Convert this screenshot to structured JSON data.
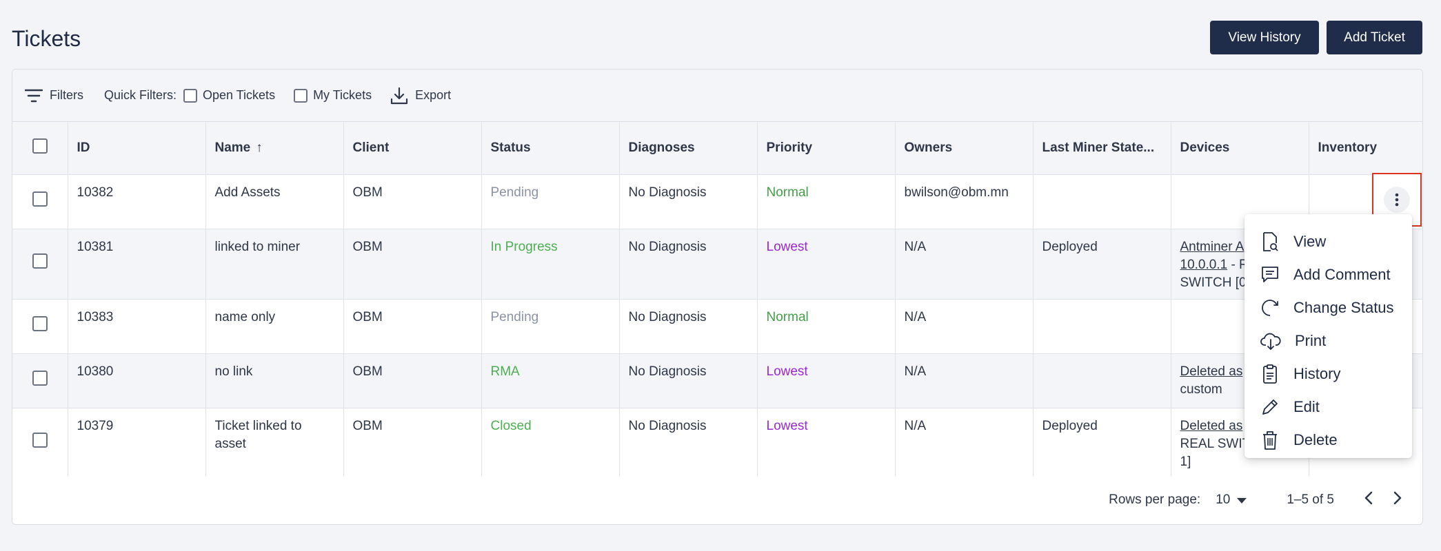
{
  "header": {
    "title": "Tickets",
    "view_history_label": "View History",
    "add_ticket_label": "Add Ticket"
  },
  "toolbar": {
    "filters_label": "Filters",
    "quick_filters_label": "Quick Filters:",
    "open_tickets_label": "Open Tickets",
    "my_tickets_label": "My Tickets",
    "export_label": "Export"
  },
  "table": {
    "columns": [
      "ID",
      "Name",
      "Client",
      "Status",
      "Diagnoses",
      "Priority",
      "Owners",
      "Last Miner State...",
      "Devices",
      "Inventory"
    ],
    "rows": [
      {
        "id": "10382",
        "name": "Add Assets",
        "client": "OBM",
        "status": "Pending",
        "diagnoses": "No Diagnosis",
        "priority": "Normal",
        "owners": "bwilson@obm.mn",
        "last_state": "",
        "devices_link": "",
        "devices_text": ""
      },
      {
        "id": "10381",
        "name": "linked to miner",
        "client": "OBM",
        "status": "In Progress",
        "diagnoses": "No Diagnosis",
        "priority": "Lowest",
        "owners": "N/A",
        "last_state": "Deployed",
        "devices_link": "Antminer A",
        "devices_link2": "10.0.0.1",
        "devices_text": " - R",
        "devices_text2": "SWITCH [0"
      },
      {
        "id": "10383",
        "name": "name only",
        "client": "OBM",
        "status": "Pending",
        "diagnoses": "No Diagnosis",
        "priority": "Normal",
        "owners": "N/A",
        "last_state": "",
        "devices_link": "",
        "devices_text": ""
      },
      {
        "id": "10380",
        "name": "no link",
        "client": "OBM",
        "status": "RMA",
        "diagnoses": "No Diagnosis",
        "priority": "Lowest",
        "owners": "N/A",
        "last_state": "",
        "devices_link": "Deleted as",
        "devices_text": "custom"
      },
      {
        "id": "10379",
        "name": "Ticket linked to asset",
        "client": "OBM",
        "status": "Closed",
        "diagnoses": "No Diagnosis",
        "priority": "Lowest",
        "owners": "N/A",
        "last_state": "Deployed",
        "devices_link": "Deleted as",
        "devices_text": "REAL SWIT",
        "devices_text2": "1]"
      }
    ]
  },
  "footer": {
    "rows_per_page_label": "Rows per page:",
    "rows_per_page_value": "10",
    "range_label": "1–5 of 5"
  },
  "menu": {
    "items": [
      "View",
      "Add Comment",
      "Change Status",
      "Print",
      "History",
      "Edit",
      "Delete"
    ]
  },
  "colors": {
    "primary_dark": "#1f2d4b",
    "status_pending": "#8b93a5",
    "status_green": "#4caf50",
    "priority_normal": "#43a047",
    "priority_lowest": "#9c27d6",
    "highlight": "#d9321f"
  }
}
